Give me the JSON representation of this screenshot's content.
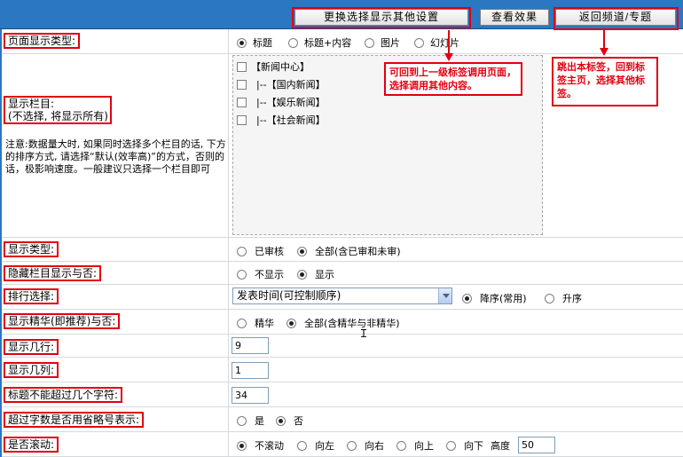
{
  "toolbar": {
    "change_settings": "更换选择显示其他设置",
    "preview": "查看效果",
    "back_channel": "返回频道/专题"
  },
  "page_type": {
    "label": "页面显示类型:",
    "options": [
      "标题",
      "标题+内容",
      "图片",
      "幻灯片"
    ],
    "selected": 0
  },
  "columns": {
    "label_line1": "显示栏目:",
    "label_line2": "(不选择, 将显示所有)",
    "note": "注意:数据量大时, 如果同时选择多个栏目的话, 下方的排序方式, 请选择“默认(效率高)”的方式，否则的话，极影响速度。一般建议只选择一个栏目即可",
    "items": [
      "【新闻中心】",
      "|--【国内新闻】",
      "|--【娱乐新闻】",
      "|--【社会新闻】"
    ]
  },
  "display_type": {
    "label": "显示类型:",
    "options": [
      "已审核",
      "全部(含已审和未审)"
    ],
    "selected": 1
  },
  "hidden_columns": {
    "label": "隐藏栏目显示与否:",
    "options": [
      "不显示",
      "显示"
    ],
    "selected": 1
  },
  "sort": {
    "label": "排行选择:",
    "select_value": "发表时间(可控制顺序)",
    "options": [
      "降序(常用)",
      "升序"
    ],
    "selected": 0
  },
  "featured": {
    "label": "显示精华(即推荐)与否:",
    "options": [
      "精华",
      "全部(含精华与非精华)"
    ],
    "selected": 1
  },
  "rows_count": {
    "label": "显示几行:",
    "value": "9"
  },
  "cols_count": {
    "label": "显示几列:",
    "value": "1"
  },
  "title_max": {
    "label": "标题不能超过几个字符:",
    "value": "34"
  },
  "ellipsis": {
    "label": "超过字数是否用省略号表示:",
    "options": [
      "是",
      "否"
    ],
    "selected": 1
  },
  "scroll": {
    "label": "是否滚动:",
    "options": [
      "不滚动",
      "向左",
      "向右",
      "向上",
      "向下"
    ],
    "selected": 0,
    "height_label": "高度",
    "height_value": "50"
  },
  "callouts": {
    "left": "可回到上一级标签调用页面，选择调用其他内容。",
    "right": "跳出本标签，回到标签主页，选择其他标签。"
  },
  "colors": {
    "annotation_red": "#e0000f",
    "header_blue": "#2b77c2"
  }
}
